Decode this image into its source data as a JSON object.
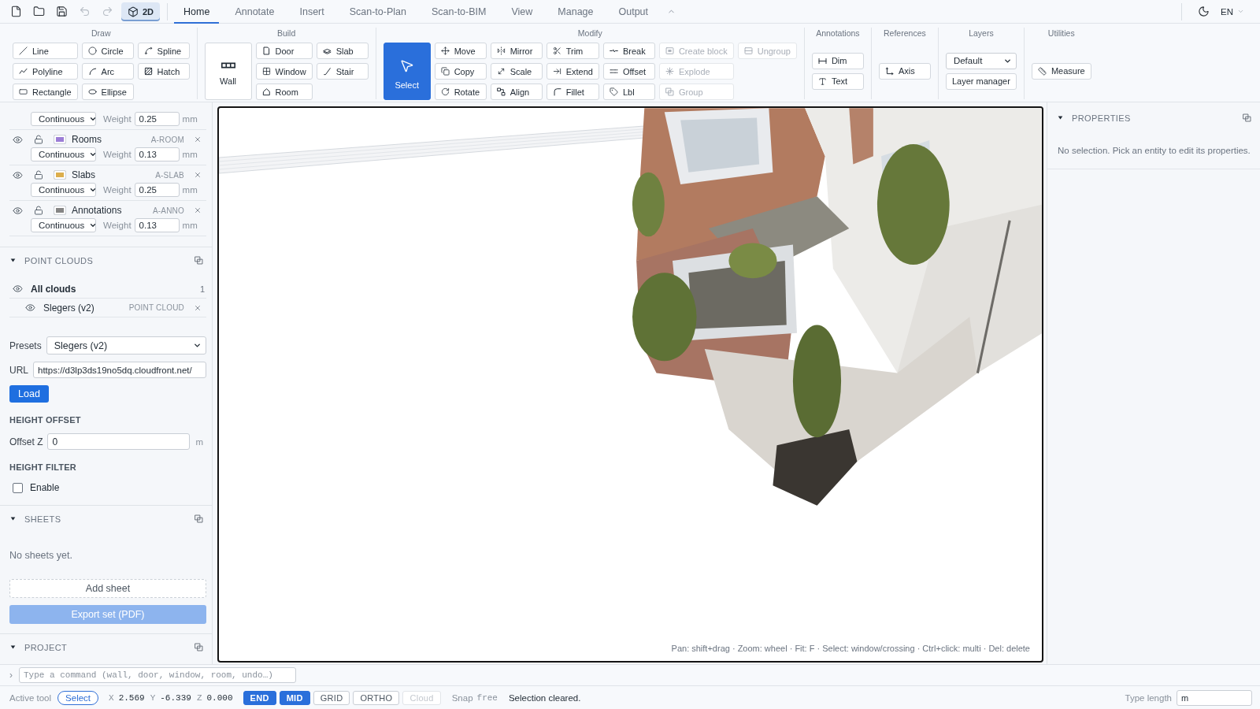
{
  "toolbar": {
    "quick_actions": [
      {
        "kind": "new",
        "disabled": false
      },
      {
        "kind": "open",
        "disabled": false
      },
      {
        "kind": "save",
        "disabled": false
      },
      {
        "kind": "undo",
        "disabled": true
      },
      {
        "kind": "redo",
        "disabled": true
      }
    ],
    "view_toggle": {
      "label": "2D",
      "on": true
    },
    "tabs": [
      {
        "label": "Home",
        "selected": true
      },
      {
        "label": "Annotate",
        "selected": false
      },
      {
        "label": "Insert",
        "selected": false
      },
      {
        "label": "Scan-to-Plan",
        "selected": false
      },
      {
        "label": "Scan-to-BIM",
        "selected": false
      },
      {
        "label": "View",
        "selected": false
      },
      {
        "label": "Manage",
        "selected": false
      },
      {
        "label": "Output",
        "selected": false
      }
    ],
    "language": "EN"
  },
  "ribbon": {
    "groups": [
      {
        "title": "Draw",
        "rows": [
          [
            {
              "label": "Line",
              "selected": false,
              "disabled": false
            },
            {
              "label": "Circle",
              "selected": false,
              "disabled": false
            },
            {
              "label": "Spline",
              "selected": false,
              "disabled": false
            }
          ],
          [
            {
              "label": "Polyline",
              "selected": false,
              "disabled": false
            },
            {
              "label": "Arc",
              "selected": false,
              "disabled": false
            },
            {
              "label": "Hatch",
              "selected": false,
              "disabled": false
            }
          ],
          [
            {
              "label": "Rectangle",
              "selected": false,
              "disabled": false
            },
            {
              "label": "Ellipse",
              "selected": false,
              "disabled": false
            }
          ]
        ]
      },
      {
        "title": "Build",
        "large": {
          "label": "Wall",
          "selected": false,
          "disabled": false
        },
        "rows": [
          [
            {
              "label": "Door",
              "selected": false,
              "disabled": false
            },
            {
              "label": "Slab",
              "selected": false,
              "disabled": false
            }
          ],
          [
            {
              "label": "Window",
              "selected": false,
              "disabled": false
            },
            {
              "label": "Stair",
              "selected": false,
              "disabled": false
            }
          ],
          [
            {
              "label": "Room",
              "selected": false,
              "disabled": false
            }
          ]
        ]
      },
      {
        "title": "Modify",
        "large": {
          "label": "Select",
          "selected": true,
          "disabled": false
        },
        "rows": [
          [
            {
              "label": "Move",
              "selected": false,
              "disabled": false
            },
            {
              "label": "Mirror",
              "selected": false,
              "disabled": false
            },
            {
              "label": "Trim",
              "selected": false,
              "disabled": false
            },
            {
              "label": "Break",
              "selected": false,
              "disabled": false
            },
            {
              "label": "Create block",
              "selected": false,
              "disabled": true
            },
            {
              "label": "Ungroup",
              "selected": false,
              "disabled": true
            }
          ],
          [
            {
              "label": "Copy",
              "selected": false,
              "disabled": false
            },
            {
              "label": "Scale",
              "selected": false,
              "disabled": false
            },
            {
              "label": "Extend",
              "selected": false,
              "disabled": false
            },
            {
              "label": "Offset",
              "selected": false,
              "disabled": false
            },
            {
              "label": "Explode",
              "selected": false,
              "disabled": true
            }
          ],
          [
            {
              "label": "Rotate",
              "selected": false,
              "disabled": false
            },
            {
              "label": "Align",
              "selected": false,
              "disabled": false
            },
            {
              "label": "Fillet",
              "selected": false,
              "disabled": false
            },
            {
              "label": "Lbl",
              "selected": false,
              "disabled": false
            },
            {
              "label": "Group",
              "selected": false,
              "disabled": true
            }
          ]
        ]
      },
      {
        "title": "Annotations",
        "rows": [
          [
            {
              "label": "Dim",
              "selected": false,
              "disabled": false
            }
          ],
          [
            {
              "label": "Text",
              "selected": false,
              "disabled": false
            }
          ]
        ]
      },
      {
        "title": "References",
        "rows": [
          [
            {
              "label": "Axis",
              "selected": false,
              "disabled": false
            }
          ]
        ]
      },
      {
        "title": "Layers",
        "rows": [
          [
            {
              "kind": "dropdown",
              "value": "Default"
            }
          ],
          [
            {
              "kind": "button",
              "label": "Layer manager",
              "selected": false,
              "disabled": false
            }
          ]
        ]
      },
      {
        "title": "Utilities",
        "rows": [
          [
            {
              "label": "Measure",
              "selected": false,
              "disabled": false
            }
          ]
        ]
      }
    ]
  },
  "layers": [
    {
      "line_type": "Continuous",
      "weight_label": "Weight",
      "weight": "0.25",
      "unit": "mm"
    },
    {
      "name": "Rooms",
      "code": "A-ROOM",
      "color": "#9c7dd6",
      "visible": true,
      "locked": false,
      "line_type": "Continuous",
      "weight_label": "Weight",
      "weight": "0.13",
      "unit": "mm"
    },
    {
      "name": "Slabs",
      "code": "A-SLAB",
      "color": "#dcae4c",
      "visible": true,
      "locked": false,
      "line_type": "Continuous",
      "weight_label": "Weight",
      "weight": "0.25",
      "unit": "mm"
    },
    {
      "name": "Annotations",
      "code": "A-ANNO",
      "color": "#858585",
      "visible": true,
      "locked": false,
      "line_type": "Continuous",
      "weight_label": "Weight",
      "weight": "0.13",
      "unit": "mm"
    }
  ],
  "point_clouds": {
    "title": "POINT CLOUDS",
    "expanded": true,
    "all": {
      "label": "All clouds",
      "count": "1",
      "visible": true
    },
    "clouds": [
      {
        "name": "Slegers (v2)",
        "type": "POINT CLOUD",
        "visible": true
      }
    ],
    "presets": {
      "label": "Presets",
      "value": "Slegers (v2)"
    },
    "url": {
      "label": "URL",
      "value": "https://d3lp3ds19no5dq.cloudfront.net/"
    },
    "load_button": "Load",
    "height_offset": {
      "title": "HEIGHT OFFSET",
      "label": "Offset Z",
      "value": "0",
      "unit": "m"
    },
    "height_filter": {
      "title": "HEIGHT FILTER",
      "label": "Enable",
      "checked": false
    }
  },
  "sheets": {
    "title": "SHEETS",
    "expanded": true,
    "empty_text": "No sheets yet.",
    "add_button": "Add sheet",
    "export_button": {
      "label": "Export set (PDF)",
      "disabled": true
    }
  },
  "project": {
    "title": "PROJECT",
    "expanded": true
  },
  "viewport": {
    "hint": "Pan: shift+drag · Zoom: wheel · Fit: F · Select: window/crossing · Ctrl+click: multi · Del: delete"
  },
  "properties": {
    "title": "PROPERTIES",
    "expanded": true,
    "empty_text": "No selection. Pick an entity to edit its properties."
  },
  "command_line": {
    "prompt": "›",
    "placeholder": "Type a command (wall, door, window, room, undo…)"
  },
  "status_bar": {
    "active_tool_label": "Active tool",
    "active_tool": "Select",
    "coordinates": [
      {
        "axis": "X",
        "value": "2.569"
      },
      {
        "axis": "Y",
        "value": "-6.339"
      },
      {
        "axis": "Z",
        "value": "0.000"
      }
    ],
    "snaps": [
      {
        "label": "END",
        "on": true,
        "disabled": false
      },
      {
        "label": "MID",
        "on": true,
        "disabled": false
      },
      {
        "label": "GRID",
        "on": false,
        "disabled": false
      },
      {
        "label": "ORTHO",
        "on": false,
        "disabled": false
      },
      {
        "label": "Cloud",
        "on": false,
        "disabled": true
      }
    ],
    "snap_label": "Snap",
    "snap_mode": "free",
    "message": "Selection cleared.",
    "type_length": {
      "label": "Type length",
      "value": "m"
    }
  }
}
